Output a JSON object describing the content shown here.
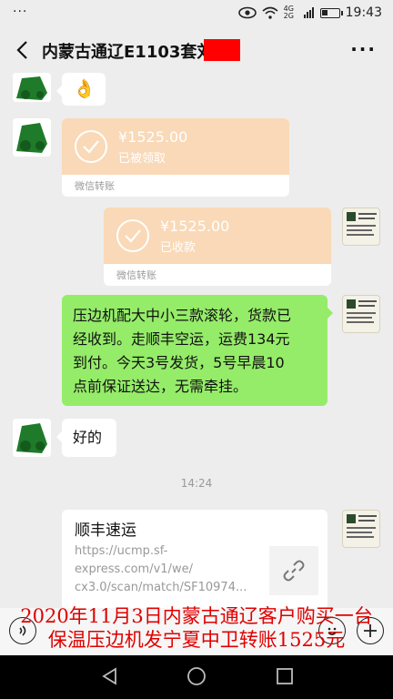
{
  "status_bar": {
    "left": "···",
    "network_top": "4G",
    "network_bottom": "2G",
    "time": "19:43"
  },
  "header": {
    "title": "内蒙古通辽E1103套刘",
    "more_label": "···"
  },
  "messages": {
    "emoji": "👌",
    "transfer1": {
      "amount": "¥1525.00",
      "status": "已被领取",
      "footer": "微信转账"
    },
    "transfer2": {
      "amount": "¥1525.00",
      "status": "已收款",
      "footer": "微信转账"
    },
    "text_out": [
      "压边机配大中小三款滚轮，货款已",
      "经收到。走顺丰空运，运费134元",
      "到付。今天3号发货，5号早晨10",
      "点前保证送达，无需牵挂。"
    ],
    "text_in": "好的",
    "timestamp": "14:24",
    "link_card": {
      "title": "顺丰速运",
      "url_lines": [
        "https://ucmp.sf-",
        "express.com/v1/we/",
        "cx3.0/scan/match/SF10974..."
      ]
    }
  },
  "caption": {
    "line1": "2020年11月3日内蒙古通辽客户购买一台",
    "line2": "保温压边机发宁夏中卫转账1525元"
  },
  "icons": {
    "back": "back-arrow-icon",
    "voice": "voice-icon",
    "emoji": "emoji-icon",
    "plus": "plus-icon",
    "link": "link-icon",
    "nav_back": "nav-back-icon",
    "nav_home": "nav-home-icon",
    "nav_recent": "nav-recent-icon"
  },
  "colors": {
    "bubble_green": "#95ec69",
    "transfer_orange": "#f9d9b7",
    "caption_red": "#e00000",
    "redaction": "#ff0000"
  }
}
